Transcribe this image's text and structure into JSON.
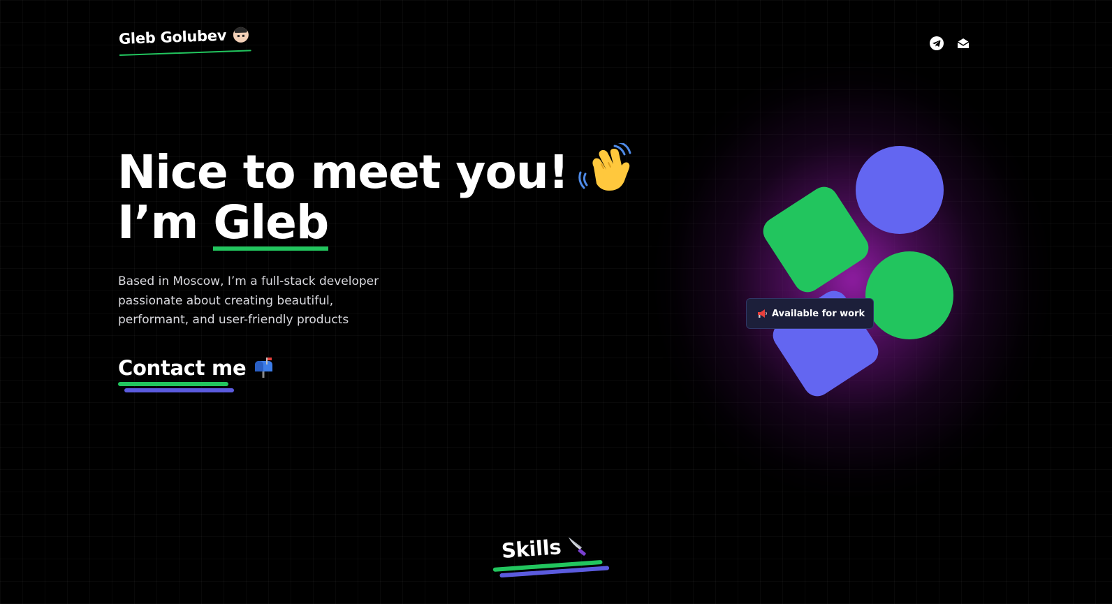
{
  "header": {
    "name": "Gleb Golubev",
    "avatar_icon": "man-face-emoji-icon",
    "social": [
      {
        "icon": "telegram-icon",
        "label": "Telegram"
      },
      {
        "icon": "mail-icon",
        "label": "Email"
      }
    ]
  },
  "hero": {
    "title_line1": "Nice to meet you!",
    "wave_icon": "waving-hand-emoji-icon",
    "title_prefix": "I’m ",
    "title_name": "Gleb",
    "bio": "Based in Moscow, I’m a full-stack developer passionate about creating beautiful, performant, and user-friendly products",
    "contact_label": "Contact me",
    "contact_icon": "mailbox-emoji-icon"
  },
  "illustration": {
    "badge_icon": "megaphone-emoji-icon",
    "badge_label": "Available for work"
  },
  "skills": {
    "label": "Skills",
    "icon": "knife-emoji-icon"
  },
  "colors": {
    "background": "#000000",
    "accent_green": "#22c55e",
    "accent_indigo": "#6366f1",
    "glow_purple": "#9b1ea8",
    "badge_bg": "#1c1f3a"
  }
}
